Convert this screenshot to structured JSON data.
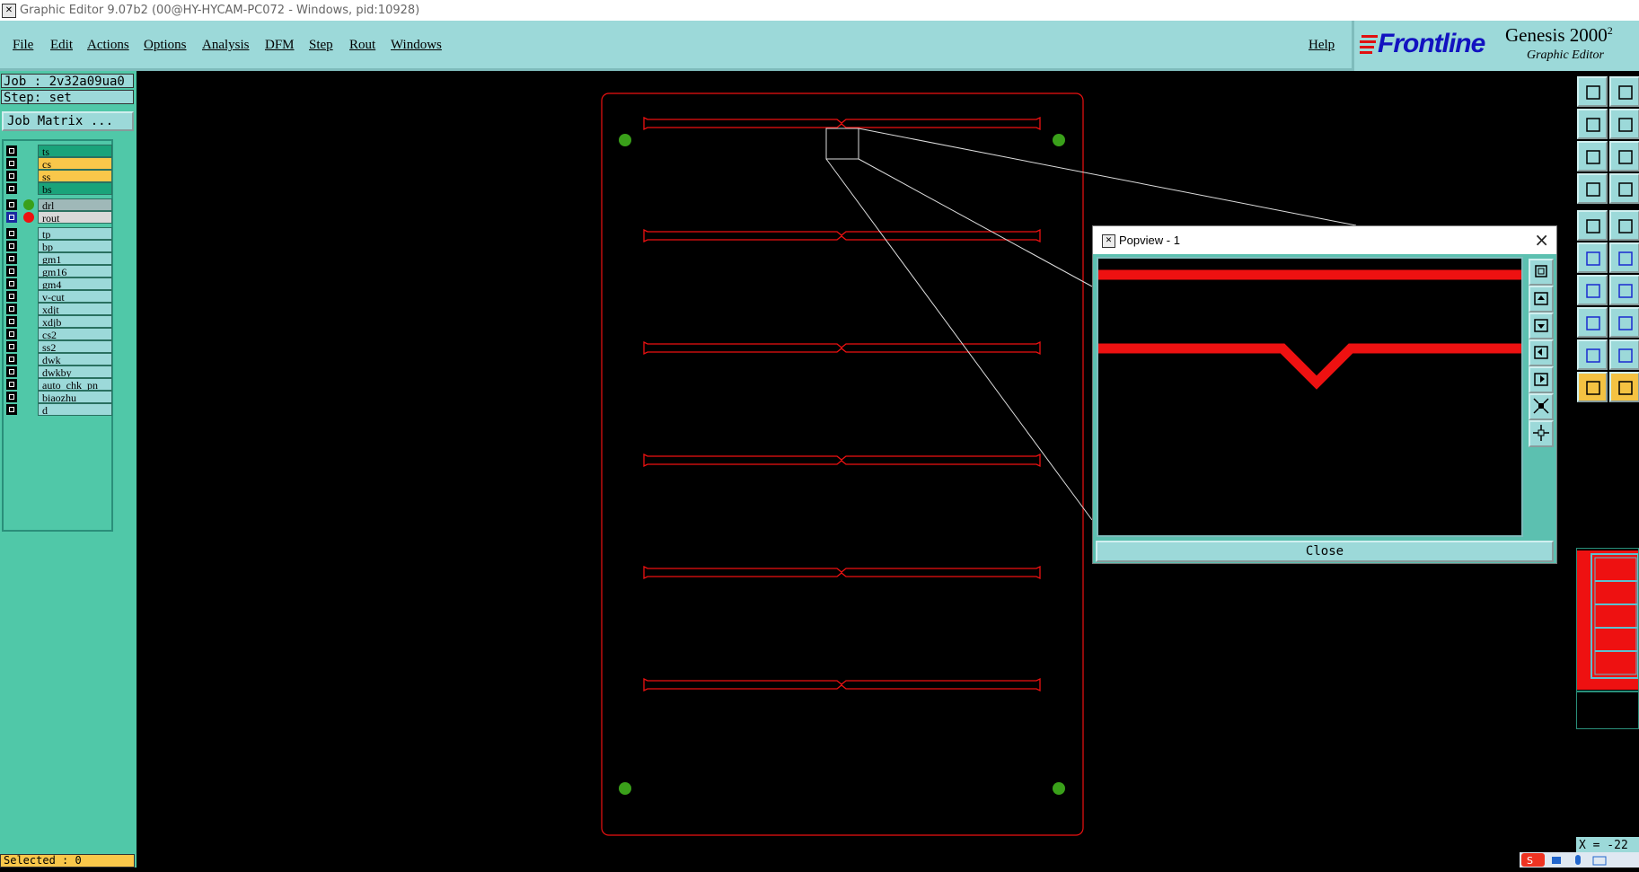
{
  "window": {
    "title": "Graphic Editor 9.07b2 (00@HY-HYCAM-PC072 - Windows, pid:10928)"
  },
  "menu": {
    "items": [
      "File",
      "Edit",
      "Actions",
      "Options",
      "Analysis",
      "DFM",
      "Step",
      "Rout",
      "Windows"
    ],
    "help": "Help"
  },
  "brand": {
    "name": "Frontline",
    "product": "Genesis 2000",
    "sup": "2",
    "subtitle": "Graphic Editor"
  },
  "job": {
    "job_label": "Job : 2v32a09ua0",
    "step_label": "Step: set",
    "matrix_button": "Job Matrix ..."
  },
  "layers": [
    {
      "name": "ts",
      "color": "#1aa37a"
    },
    {
      "name": "cs",
      "color": "#f9c74a"
    },
    {
      "name": "ss",
      "color": "#f9c74a"
    },
    {
      "name": "bs",
      "color": "#1aa37a"
    },
    {
      "name": "drl",
      "color": "#9fb8b8",
      "dot": "#3aa01a"
    },
    {
      "name": "rout",
      "color": "#d8d8d8",
      "dot": "#ee1111",
      "active": true
    },
    {
      "name": "tp",
      "color": "#9cd9d9"
    },
    {
      "name": "bp",
      "color": "#9cd9d9"
    },
    {
      "name": "gm1",
      "color": "#9cd9d9"
    },
    {
      "name": "gm16",
      "color": "#9cd9d9"
    },
    {
      "name": "gm4",
      "color": "#9cd9d9"
    },
    {
      "name": "v-cut",
      "color": "#9cd9d9"
    },
    {
      "name": "xdjt",
      "color": "#9cd9d9"
    },
    {
      "name": "xdjb",
      "color": "#9cd9d9"
    },
    {
      "name": "cs2",
      "color": "#9cd9d9"
    },
    {
      "name": "ss2",
      "color": "#9cd9d9"
    },
    {
      "name": "dwk",
      "color": "#9cd9d9"
    },
    {
      "name": "dwkby",
      "color": "#9cd9d9"
    },
    {
      "name": "auto_chk_pn",
      "color": "#9cd9d9"
    },
    {
      "name": "biaozhu",
      "color": "#9cd9d9"
    },
    {
      "name": "d",
      "color": "#9cd9d9"
    }
  ],
  "status": {
    "selected": "Selected : 0",
    "coord": "X = -22"
  },
  "popview": {
    "title": "Popview - 1",
    "close_label": "Close"
  },
  "colors": {
    "rout": "#ee1111",
    "drill": "#3aa01a",
    "panel": "#9cd9d9",
    "side": "#50c8a8"
  }
}
